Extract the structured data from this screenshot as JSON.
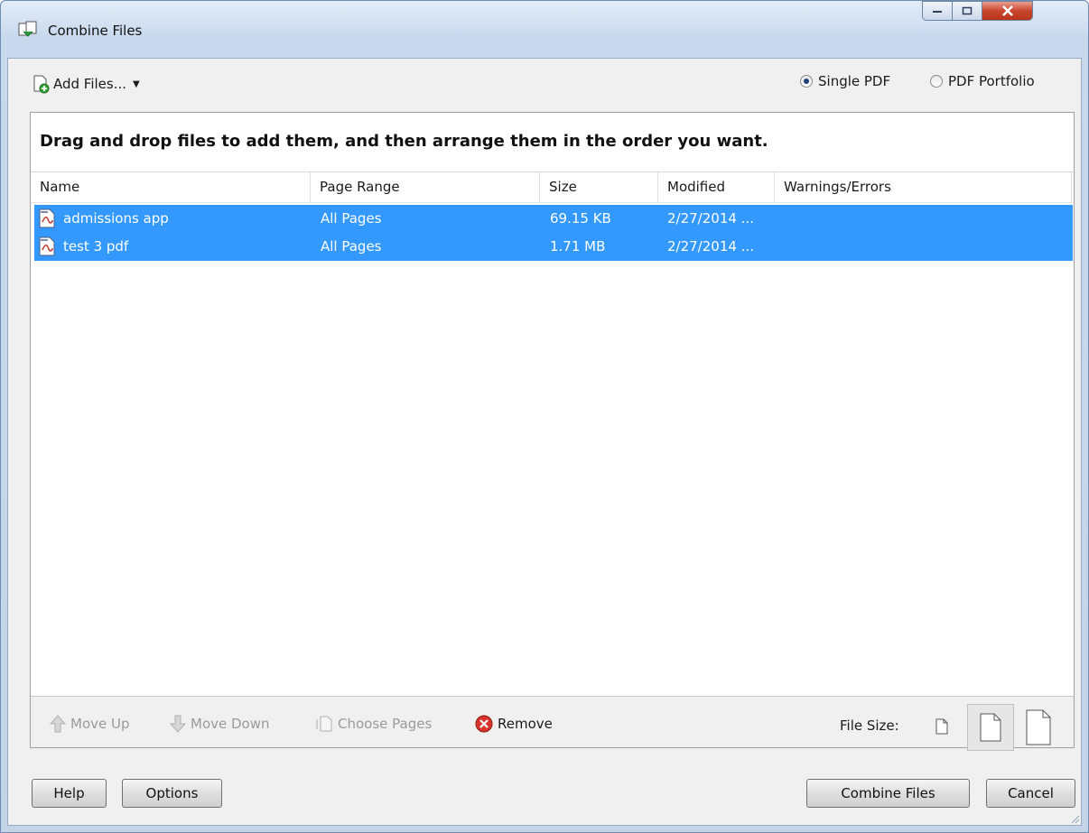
{
  "window": {
    "title": "Combine Files"
  },
  "toolbar": {
    "add_files_label": "Add Files..."
  },
  "output_mode": {
    "single_pdf_label": "Single PDF",
    "portfolio_label": "PDF Portfolio",
    "selected": "Single PDF"
  },
  "instructions": "Drag and drop files to add them, and then arrange them in the order you want.",
  "columns": [
    "Name",
    "Page Range",
    "Size",
    "Modified",
    "Warnings/Errors"
  ],
  "files": [
    {
      "name": "admissions app",
      "page_range": "All Pages",
      "size": "69.15 KB",
      "modified": "2/27/2014 ...",
      "warnings": ""
    },
    {
      "name": "test 3 pdf",
      "page_range": "All Pages",
      "size": "1.71 MB",
      "modified": "2/27/2014 ...",
      "warnings": ""
    }
  ],
  "actions": {
    "move_up": "Move Up",
    "move_down": "Move Down",
    "choose_pages": "Choose Pages",
    "remove": "Remove"
  },
  "file_size": {
    "label": "File Size:",
    "selected": "medium"
  },
  "buttons": {
    "help": "Help",
    "options": "Options",
    "combine": "Combine Files",
    "cancel": "Cancel"
  },
  "colors": {
    "selection": "#3399ff",
    "accent": "#1f3f78"
  }
}
